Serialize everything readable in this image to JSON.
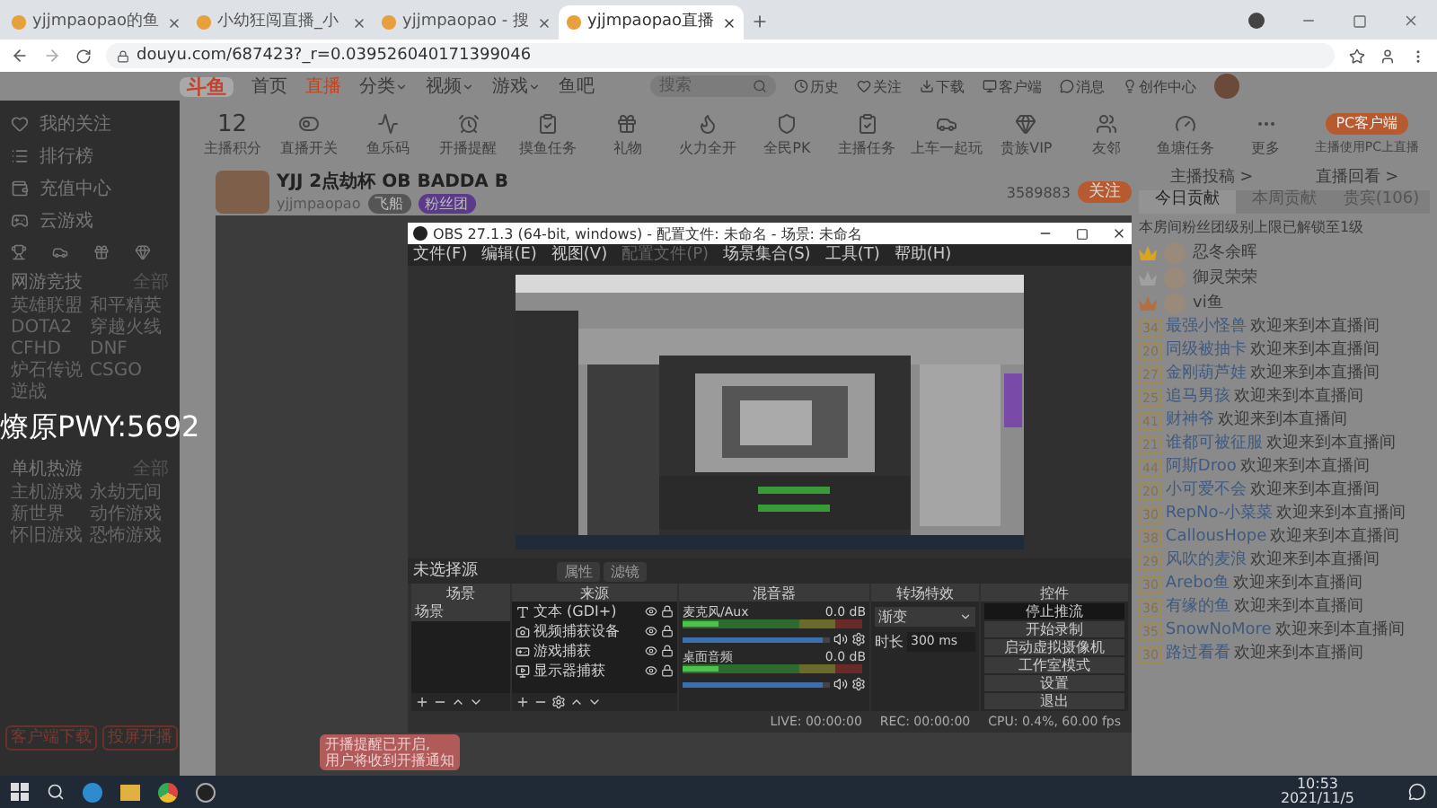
{
  "browser": {
    "tabs": [
      {
        "title": "yjjmpaopao的鱼",
        "selected": false
      },
      {
        "title": "小幼狂闯直播_小",
        "selected": false
      },
      {
        "title": "yjjmpaopao - 搜",
        "selected": false
      },
      {
        "title": "yjjmpaopao直播",
        "selected": true
      }
    ],
    "url": "douyu.com/687423?_r=0.039526040171399046"
  },
  "site": {
    "logo": "斗鱼",
    "nav": [
      {
        "label": "首页",
        "selected": false,
        "dropdown": false
      },
      {
        "label": "直播",
        "selected": true,
        "dropdown": false
      },
      {
        "label": "分类",
        "selected": false,
        "dropdown": true
      },
      {
        "label": "视频",
        "selected": false,
        "dropdown": true
      },
      {
        "label": "游戏",
        "selected": false,
        "dropdown": true
      },
      {
        "label": "鱼吧",
        "selected": false,
        "dropdown": false
      }
    ],
    "search": {
      "placeholder": "搜索"
    },
    "header_icons": [
      {
        "kind": "clock",
        "label": "历史"
      },
      {
        "kind": "heart",
        "label": "关注"
      },
      {
        "kind": "download",
        "label": "下载"
      },
      {
        "kind": "monitor",
        "label": "客户端"
      },
      {
        "kind": "message",
        "label": "消息"
      },
      {
        "kind": "bulb",
        "label": "创作中心"
      }
    ]
  },
  "sidebar": {
    "items": [
      {
        "kind": "heart",
        "label": "我的关注"
      },
      {
        "kind": "list",
        "label": "排行榜"
      },
      {
        "kind": "wallet",
        "label": "充值中心"
      },
      {
        "kind": "gamepad",
        "label": "云游戏"
      }
    ],
    "sections": [
      {
        "title": "网游竞技",
        "more": "全部",
        "games": [
          "英雄联盟",
          "和平精英",
          "DOTA2",
          "穿越火线",
          "CFHD",
          "DNF",
          "炉石传说",
          "CSGO",
          "逆战"
        ]
      },
      {
        "title": "单机热游",
        "more": "全部",
        "games": [
          "主机游戏",
          "永劫无间",
          "新世界",
          "动作游戏",
          "怀旧游戏",
          "恐怖游戏"
        ]
      }
    ],
    "buttons": [
      "客户端下载",
      "投屏开播"
    ]
  },
  "features": {
    "score": "12",
    "score_label": "主播积分",
    "items": [
      {
        "kind": "toggle",
        "label": "直播开关"
      },
      {
        "kind": "wave",
        "label": "鱼乐码"
      },
      {
        "kind": "alarm",
        "label": "开播提醒"
      },
      {
        "kind": "task",
        "label": "摸鱼任务"
      },
      {
        "kind": "gift",
        "label": "礼物"
      },
      {
        "kind": "fire",
        "label": "火力全开"
      },
      {
        "kind": "shield",
        "label": "全民PK"
      },
      {
        "kind": "task",
        "label": "主播任务"
      },
      {
        "kind": "car",
        "label": "上车一起玩"
      },
      {
        "kind": "gem",
        "label": "贵族VIP"
      },
      {
        "kind": "users",
        "label": "友邻"
      },
      {
        "kind": "gauge",
        "label": "鱼塘任务"
      },
      {
        "kind": "more",
        "label": "更多"
      }
    ],
    "client_button": "PC客户端",
    "client_note": "主播使用PC上直播"
  },
  "streamer": {
    "title": "YJJ 2点劫杯 OB BADDA B",
    "name": "yjjmpaopao",
    "followers": "3589883",
    "follow_button": "关注",
    "tag": "飞船",
    "fan_button": "粉丝团"
  },
  "chat": {
    "links": [
      "主播投稿 >",
      "直播回看 >"
    ],
    "tabs": [
      {
        "label": "今日贡献",
        "selected": true
      },
      {
        "label": "本周贡献",
        "selected": false
      },
      {
        "label": "贵宾(106)",
        "selected": false
      }
    ],
    "notice": "本房间粉丝团级别上限已解锁至1级",
    "top": [
      {
        "name": "忍冬余晖",
        "color": "#d9a520"
      },
      {
        "name": "御灵荣荣",
        "color": "#a0a0a0"
      },
      {
        "name": "vi鱼",
        "color": "#b07040"
      }
    ],
    "messages": [
      {
        "level": "34",
        "name": "最强小怪兽",
        "text": "欢迎来到本直播间"
      },
      {
        "level": "20",
        "name": "同级被抽卡",
        "text": "欢迎来到本直播间"
      },
      {
        "level": "27",
        "name": "金刚葫芦娃",
        "text": "欢迎来到本直播间"
      },
      {
        "level": "25",
        "name": "追马男孩",
        "text": "欢迎来到本直播间"
      },
      {
        "level": "41",
        "name": "财神爷",
        "text": "欢迎来到本直播间"
      },
      {
        "level": "21",
        "name": "谁都可被征服",
        "text": "欢迎来到本直播间"
      },
      {
        "level": "44",
        "name": "阿斯Droo",
        "text": "欢迎来到本直播间"
      },
      {
        "level": "20",
        "name": "小可爱不会",
        "text": "欢迎来到本直播间"
      },
      {
        "level": "30",
        "name": "RepNo-小菜菜",
        "text": "欢迎来到本直播间"
      },
      {
        "level": "38",
        "name": "CallousHope",
        "text": "欢迎来到本直播间"
      },
      {
        "level": "29",
        "name": "风吹的麦浪",
        "text": "欢迎来到本直播间"
      },
      {
        "level": "30",
        "name": "Arebo鱼",
        "text": "欢迎来到本直播间"
      },
      {
        "level": "36",
        "name": "有缘的鱼",
        "text": "欢迎来到本直播间"
      },
      {
        "level": "35",
        "name": "SnowNoMore",
        "text": "欢迎来到本直播间"
      },
      {
        "level": "30",
        "name": "路过看看",
        "text": "欢迎来到本直播间"
      }
    ]
  },
  "obs": {
    "title": "OBS 27.1.3 (64-bit, windows) - 配置文件: 未命名 - 场景: 未命名",
    "menu": [
      {
        "label": "文件(F)",
        "disabled": false
      },
      {
        "label": "编辑(E)",
        "disabled": false
      },
      {
        "label": "视图(V)",
        "disabled": false
      },
      {
        "label": "配置文件(P)",
        "disabled": true
      },
      {
        "label": "场景集合(S)",
        "disabled": false
      },
      {
        "label": "工具(T)",
        "disabled": false
      },
      {
        "label": "帮助(H)",
        "disabled": false
      }
    ],
    "source_bar": {
      "label": "未选择源",
      "buttons": [
        "属性",
        "滤镜"
      ]
    },
    "scenes": {
      "title": "场景",
      "items": [
        {
          "label": "场景",
          "selected": true
        }
      ]
    },
    "sources": {
      "title": "来源",
      "items": [
        {
          "kind": "text",
          "label": "文本 (GDI+)"
        },
        {
          "kind": "camera",
          "label": "视频捕获设备"
        },
        {
          "kind": "game",
          "label": "游戏捕获"
        },
        {
          "kind": "display",
          "label": "显示器捕获"
        }
      ]
    },
    "mixer": {
      "title": "混音器",
      "channels": [
        {
          "name": "麦克风/Aux",
          "reading": "0.0 dB",
          "level": 0.95
        },
        {
          "name": "桌面音频",
          "reading": "0.0 dB",
          "level": 0.95
        }
      ]
    },
    "transitions": {
      "title": "转场特效",
      "value": "渐变",
      "duration_label": "时长",
      "duration": "300 ms"
    },
    "controls": {
      "title": "控件",
      "buttons": [
        {
          "label": "停止推流",
          "selected": true
        },
        {
          "label": "开始录制",
          "selected": false
        },
        {
          "label": "启动虚拟摄像机",
          "selected": false
        },
        {
          "label": "工作室模式",
          "selected": false
        },
        {
          "label": "设置",
          "selected": false
        },
        {
          "label": "退出",
          "selected": false
        }
      ]
    },
    "status": {
      "live": "LIVE: 00:00:00",
      "rec": "REC: 00:00:00",
      "cpu": "CPU: 0.4%, 60.00 fps"
    }
  },
  "toast": {
    "lines": [
      "开播提醒已开启,",
      "用户将收到开播通知"
    ]
  },
  "overlay_text": "燎原PWY:5692",
  "taskbar": {
    "time": "10:53",
    "date": "2021/11/5"
  }
}
